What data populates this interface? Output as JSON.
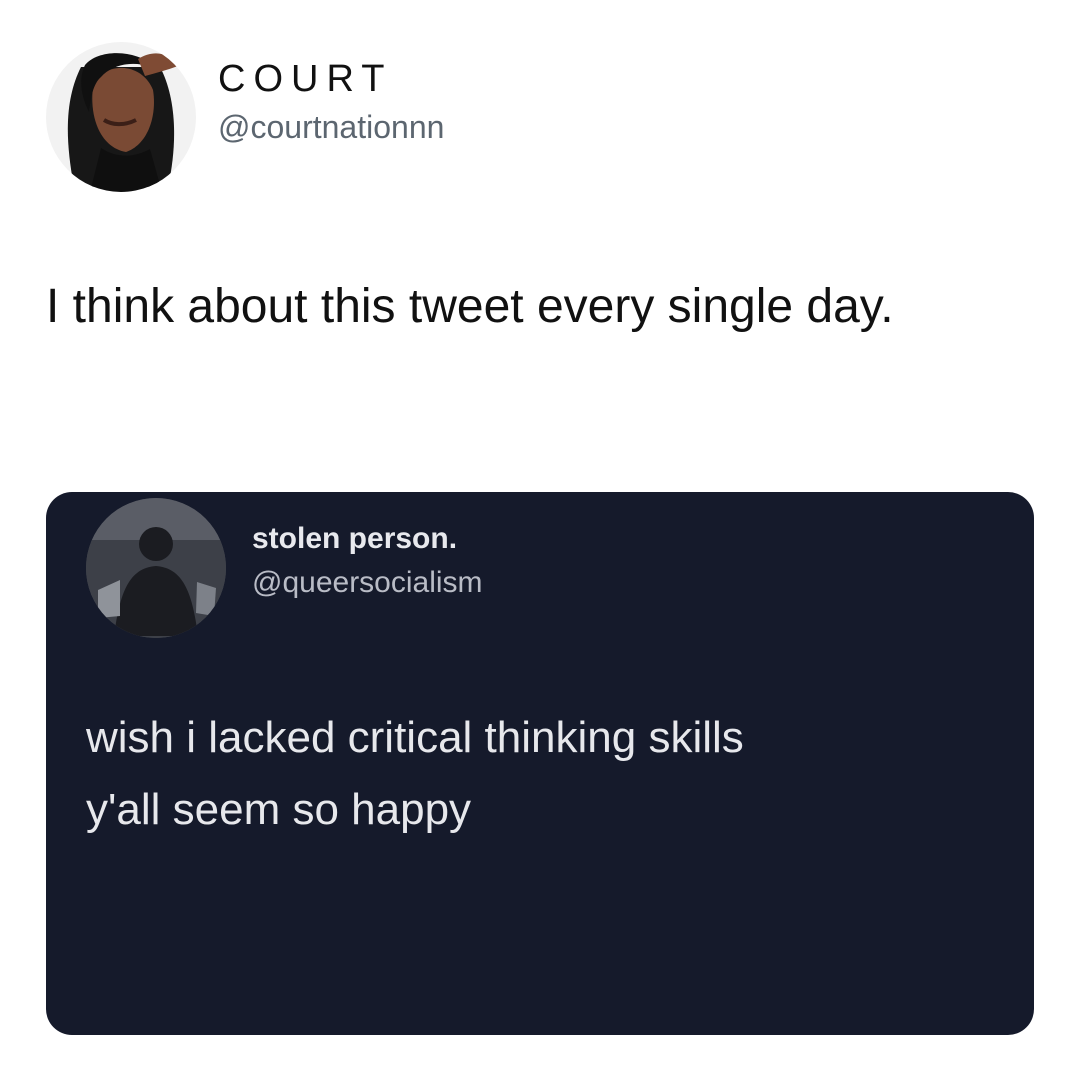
{
  "tweet": {
    "author": {
      "display_name": "COURT",
      "handle": "@courtnationnn"
    },
    "text": "I think about this tweet every single day."
  },
  "quoted_tweet": {
    "author": {
      "display_name": "stolen person.",
      "handle": "@queersocialism"
    },
    "text_line_1": "wish i lacked critical thinking skills",
    "text_line_2": "y'all seem so happy"
  },
  "colors": {
    "background": "#ffffff",
    "quoted_card_background": "#151a2b",
    "primary_text": "#111111",
    "secondary_text": "#5c6670",
    "quoted_primary_text": "#e8e9ee",
    "quoted_secondary_text": "#b9bcc6"
  }
}
